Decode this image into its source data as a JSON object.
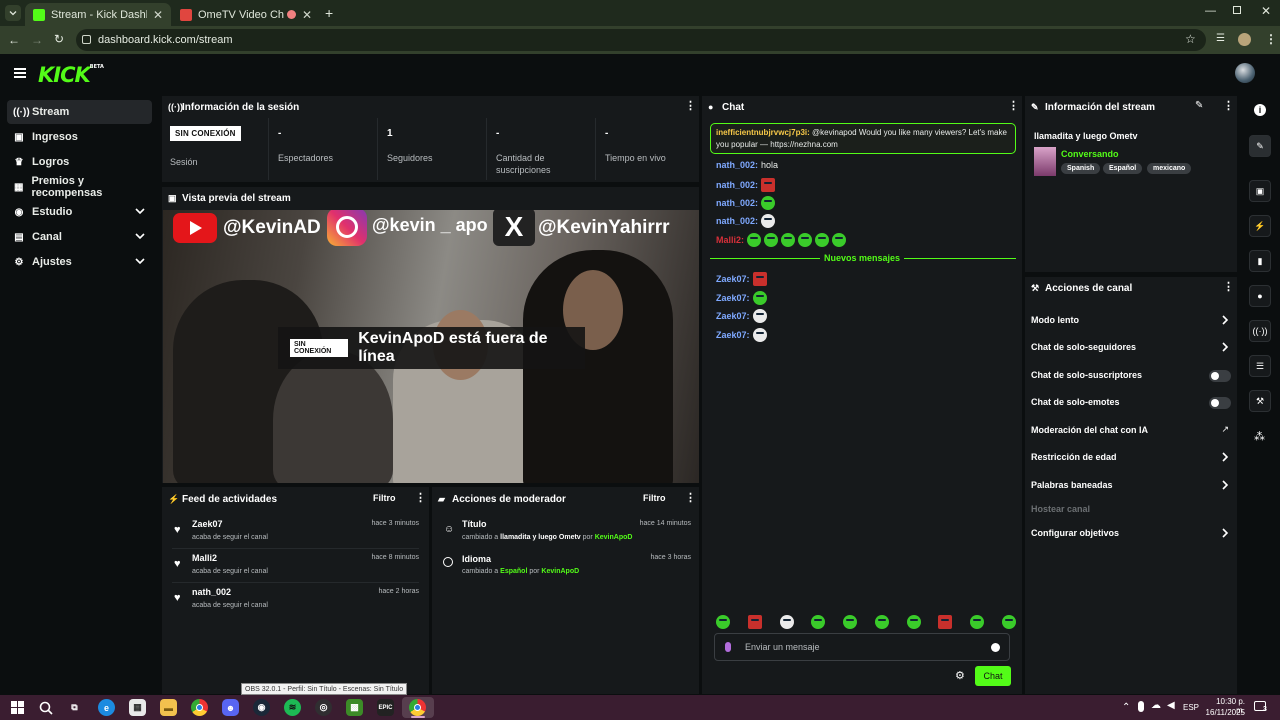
{
  "browser": {
    "tabs": [
      {
        "title": "Stream - Kick Dashboard"
      },
      {
        "title": "OmeTV Video Chat — Ome"
      }
    ],
    "url": "dashboard.kick.com/stream"
  },
  "header": {
    "logo": "KICK",
    "logo_badge": "BETA"
  },
  "sidebar": {
    "items": [
      {
        "label": "Stream"
      },
      {
        "label": "Ingresos"
      },
      {
        "label": "Logros"
      },
      {
        "label": "Premios y recompensas"
      },
      {
        "label": "Estudio"
      },
      {
        "label": "Canal"
      },
      {
        "label": "Ajustes"
      }
    ]
  },
  "session": {
    "title": "Información de la sesión",
    "status_badge": "SIN CONEXIÓN",
    "session_label": "Sesión",
    "stats": [
      {
        "value": "-",
        "label": "Espectadores"
      },
      {
        "value": "1",
        "label": "Seguidores"
      },
      {
        "value": "-",
        "label": "Cantidad de suscripciones"
      },
      {
        "value": "-",
        "label": "Tiempo en vivo"
      }
    ]
  },
  "preview": {
    "title": "Vista previa del stream",
    "overlay_handles": [
      "@KevinAD",
      "@kevin _ apo",
      "@KevinYahirrr"
    ],
    "offline_badge": "SIN CONEXIÓN",
    "offline_text": "KevinApoD está fuera de línea"
  },
  "feed": {
    "title": "Feed de actividades",
    "filter": "Filtro",
    "items": [
      {
        "name": "Zaek07",
        "desc": "acaba de seguir el canal",
        "time": "hace 3 minutos"
      },
      {
        "name": "Malli2",
        "desc": "acaba de seguir el canal",
        "time": "hace 8 minutos"
      },
      {
        "name": "nath_002",
        "desc": "acaba de seguir el canal",
        "time": "hace 2 horas"
      }
    ]
  },
  "modactions": {
    "title": "Acciones de moderador",
    "filter": "Filtro",
    "items": [
      {
        "name": "Título",
        "pre": "cambiado a",
        "value": "llamadita y luego Ometv",
        "by": "por",
        "user": "KevinApoD",
        "time": "hace 14 minutos"
      },
      {
        "name": "Idioma",
        "pre": "cambiado a",
        "value": "Español",
        "by": "por",
        "user": "KevinApoD",
        "time": "hace 3 horas"
      }
    ]
  },
  "chat": {
    "title": "Chat",
    "pinned_user": "inefficientnubjrvwcj7p3i:",
    "pinned_text": "@kevinapod Would you like many viewers? Let's make you popular — https://nezhna.com",
    "messages": [
      {
        "user": "nath_002:",
        "text": "hola"
      },
      {
        "user": "nath_002:",
        "text": ""
      },
      {
        "user": "nath_002:",
        "text": ""
      },
      {
        "user": "nath_002:",
        "text": ""
      },
      {
        "user": "Malli2:",
        "text": ""
      }
    ],
    "new_messages": "Nuevos mensajes",
    "messages2": [
      {
        "user": "Zaek07:"
      },
      {
        "user": "Zaek07:"
      },
      {
        "user": "Zaek07:"
      },
      {
        "user": "Zaek07:"
      }
    ],
    "input_placeholder": "Enviar un mensaje",
    "send_label": "Chat"
  },
  "streaminfo": {
    "title": "Información del stream",
    "stream_title": "llamadita y luego Ometv",
    "category": "Conversando",
    "tags": [
      "Spanish",
      "Español",
      "mexicano"
    ]
  },
  "channelactions": {
    "title": "Acciones de canal",
    "items": [
      {
        "label": "Modo lento"
      },
      {
        "label": "Chat de solo-seguidores"
      },
      {
        "label": "Chat de solo-suscriptores"
      },
      {
        "label": "Chat de solo-emotes"
      },
      {
        "label": "Moderación del chat con IA"
      },
      {
        "label": "Restricción de edad"
      },
      {
        "label": "Palabras baneadas"
      },
      {
        "label": "Hostear canal"
      },
      {
        "label": "Configurar objetivos"
      }
    ]
  },
  "tooltip": "OBS 32.0.1 - Perfil: Sin Título - Escenas: Sin Título",
  "taskbar": {
    "lang": "ESP",
    "time": "10:30 p. m.",
    "date": "16/11/2025",
    "notif": "3"
  },
  "colors": {
    "accent": "#53fc18",
    "panel": "#16191b",
    "bg": "#0b0e0f"
  }
}
